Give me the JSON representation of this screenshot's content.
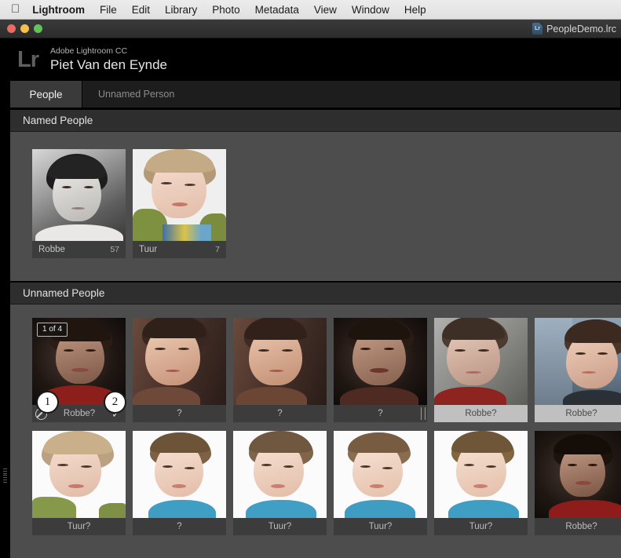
{
  "menubar": {
    "apple_icon": "apple-logo",
    "items": [
      {
        "label": "Lightroom",
        "bold": true
      },
      {
        "label": "File"
      },
      {
        "label": "Edit"
      },
      {
        "label": "Library"
      },
      {
        "label": "Photo"
      },
      {
        "label": "Metadata"
      },
      {
        "label": "View"
      },
      {
        "label": "Window"
      },
      {
        "label": "Help"
      }
    ]
  },
  "titlebar": {
    "document_name": "PeopleDemo.lrc",
    "badge_text": "Lr",
    "traffic_lights": [
      "close",
      "minimize",
      "zoom"
    ]
  },
  "identity": {
    "logo": "Lr",
    "product": "Adobe Lightroom CC",
    "owner": "Piet Van den Eynde"
  },
  "tabs": [
    {
      "label": "People",
      "active": true
    },
    {
      "label": "Unnamed Person",
      "active": false
    }
  ],
  "named_section": {
    "title": "Named People",
    "people": [
      {
        "name": "Robbe",
        "count": "57",
        "style": "bw-boy"
      },
      {
        "name": "Tuur",
        "count": "7",
        "style": "blond-boy"
      }
    ]
  },
  "unnamed_section": {
    "title": "Unnamed People",
    "rows": [
      [
        {
          "label": "Robbe?",
          "selected": false,
          "active": true,
          "badge": "1 of 4",
          "deny_icon": "deny-circle-icon",
          "confirm_icon": "check-icon",
          "style": "dark-smile"
        },
        {
          "label": "?",
          "selected": false,
          "active": false,
          "style": "brown-thinking"
        },
        {
          "label": "?",
          "selected": false,
          "active": false,
          "style": "brown-thinking2"
        },
        {
          "label": "?",
          "selected": false,
          "active": false,
          "scroll_nub": true,
          "style": "dark-grin"
        },
        {
          "label": "Robbe?",
          "selected": true,
          "active": false,
          "style": "gray-room"
        },
        {
          "label": "Robbe?",
          "selected": true,
          "active": false,
          "style": "blue-window"
        }
      ],
      [
        {
          "label": "Tuur?",
          "selected": false,
          "active": false,
          "style": "white-curly"
        },
        {
          "label": "?",
          "selected": false,
          "active": false,
          "style": "white-teal1"
        },
        {
          "label": "Tuur?",
          "selected": false,
          "active": false,
          "style": "white-teal2"
        },
        {
          "label": "Tuur?",
          "selected": false,
          "active": false,
          "style": "white-teal3"
        },
        {
          "label": "Tuur?",
          "selected": false,
          "active": false,
          "style": "white-teal4"
        },
        {
          "label": "Robbe?",
          "selected": false,
          "active": false,
          "style": "dark-red"
        }
      ]
    ]
  },
  "annotations": [
    {
      "marker": "1",
      "describes": "reject-face-button"
    },
    {
      "marker": "2",
      "describes": "confirm-face-button"
    }
  ],
  "colors": {
    "panel_bg": "#4d4d4d",
    "section_header_bg": "#2e2e2e",
    "label_bg": "#3c3c3c",
    "selected_label_bg": "#c0c0c0",
    "active_tab_bg": "#3a3a3a",
    "window_chrome": "#2c2c2c"
  }
}
